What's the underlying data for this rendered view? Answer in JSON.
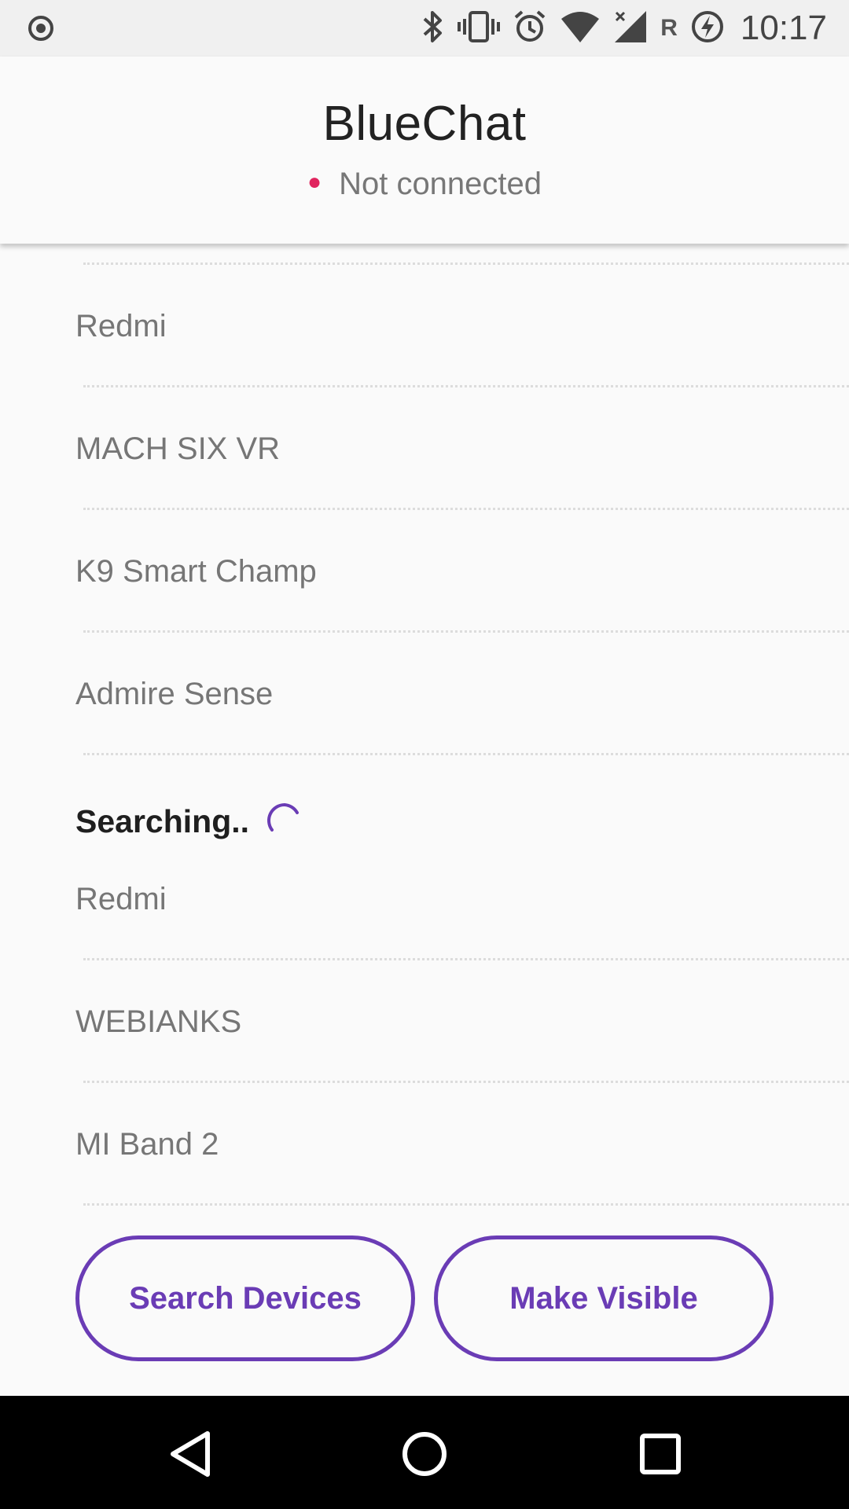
{
  "status_bar": {
    "time": "10:17",
    "roaming_indicator": "R",
    "icons": [
      "record-icon",
      "bluetooth-icon",
      "vibrate-icon",
      "alarm-icon",
      "wifi-icon",
      "cell-signal-icon",
      "battery-charging-icon"
    ]
  },
  "header": {
    "title": "BlueChat",
    "connection_status": "Not connected",
    "status_dot_color": "#e0245e"
  },
  "paired_devices": [
    "Redmi",
    "MACH SIX VR",
    "K9 Smart Champ",
    "Admire Sense"
  ],
  "searching": {
    "label": "Searching..",
    "spinner_color": "#6a3cb5"
  },
  "found_devices": [
    "Redmi",
    "WEBIANKS",
    "MI Band 2"
  ],
  "buttons": {
    "search": "Search Devices",
    "visible": "Make Visible"
  },
  "accent_color": "#6a3cb5",
  "nav_bar": {
    "icons": [
      "back-icon",
      "home-icon",
      "recents-icon"
    ]
  }
}
